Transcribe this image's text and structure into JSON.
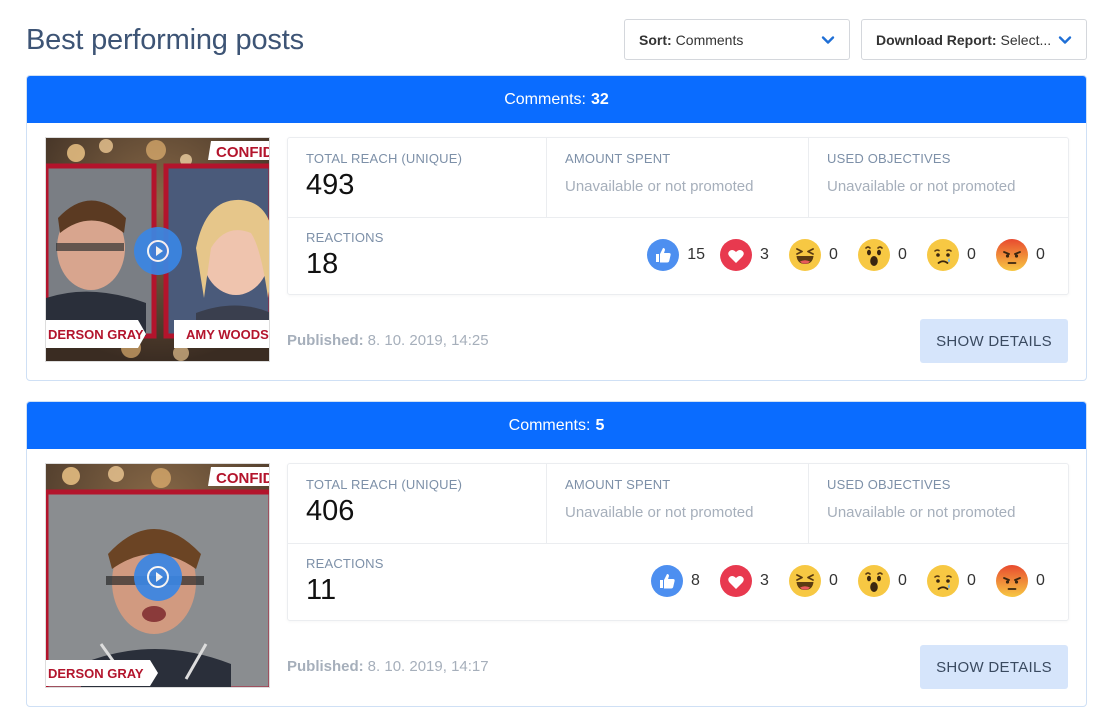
{
  "page": {
    "title": "Best performing posts"
  },
  "sort": {
    "label": "Sort:",
    "value": "Comments"
  },
  "report": {
    "label": "Download Report:",
    "value": "Select..."
  },
  "colors": {
    "header": "#0a6cff",
    "like": "#4d8ff0",
    "love": "#e8394f",
    "haha": "#f7c843",
    "angry": "#f0623a"
  },
  "labels": {
    "comments": "Comments:",
    "total_reach": "TOTAL REACH (UNIQUE)",
    "amount_spent": "AMOUNT SPENT",
    "used_objectives": "USED OBJECTIVES",
    "reactions": "REACTIONS",
    "unavailable": "Unavailable or not promoted",
    "published": "Published:",
    "show_details": "SHOW DETAILS"
  },
  "posts": [
    {
      "comments": "32",
      "reach": "493",
      "reactions_total": "18",
      "published": "8. 10. 2019, 14:25",
      "thumb_texts": [
        "CONFIDE",
        "DERSON GRAY",
        "AMY WOODS"
      ],
      "reactions": [
        {
          "type": "like-icon",
          "count": "15"
        },
        {
          "type": "love-icon",
          "count": "3"
        },
        {
          "type": "haha-icon",
          "count": "0"
        },
        {
          "type": "wow-icon",
          "count": "0"
        },
        {
          "type": "sad-icon",
          "count": "0"
        },
        {
          "type": "angry-icon",
          "count": "0"
        }
      ]
    },
    {
      "comments": "5",
      "reach": "406",
      "reactions_total": "11",
      "published": "8. 10. 2019, 14:17",
      "thumb_texts": [
        "CONFIDE",
        "DERSON GRAY"
      ],
      "reactions": [
        {
          "type": "like-icon",
          "count": "8"
        },
        {
          "type": "love-icon",
          "count": "3"
        },
        {
          "type": "haha-icon",
          "count": "0"
        },
        {
          "type": "wow-icon",
          "count": "0"
        },
        {
          "type": "sad-icon",
          "count": "0"
        },
        {
          "type": "angry-icon",
          "count": "0"
        }
      ]
    }
  ]
}
